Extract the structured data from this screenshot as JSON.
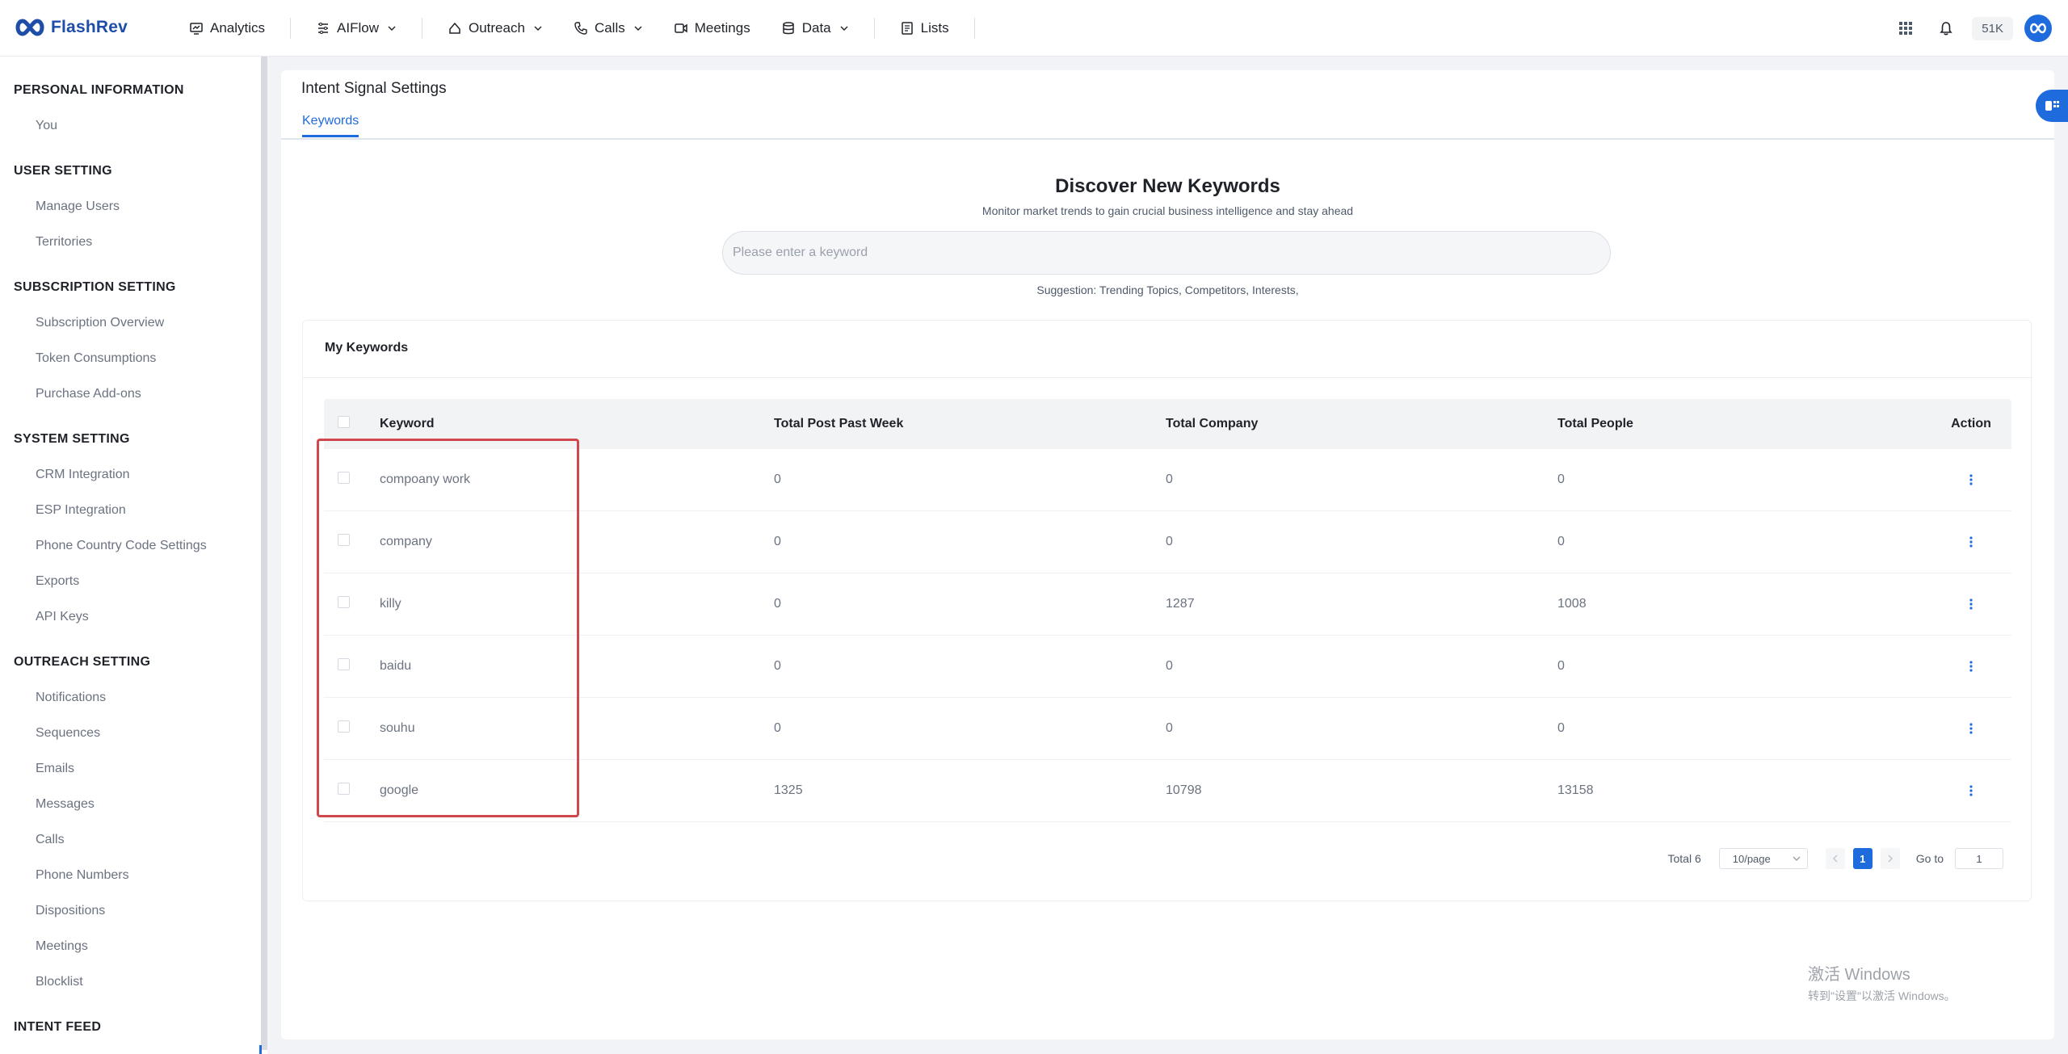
{
  "brand": {
    "name": "FlashRev"
  },
  "nav": {
    "items": [
      {
        "label": "Analytics",
        "icon": "analytics-icon",
        "dropdown": false
      },
      {
        "label": "AIFlow",
        "icon": "flow-icon",
        "dropdown": true
      },
      {
        "label": "Outreach",
        "icon": "outreach-icon",
        "dropdown": true
      },
      {
        "label": "Calls",
        "icon": "phone-icon",
        "dropdown": true
      },
      {
        "label": "Meetings",
        "icon": "video-icon",
        "dropdown": false
      },
      {
        "label": "Data",
        "icon": "database-icon",
        "dropdown": true
      },
      {
        "label": "Lists",
        "icon": "list-icon",
        "dropdown": false
      }
    ],
    "credits": "51K"
  },
  "sidebar": {
    "sections": [
      {
        "title": "PERSONAL INFORMATION",
        "items": [
          "You"
        ]
      },
      {
        "title": "USER SETTING",
        "items": [
          "Manage Users",
          "Territories"
        ]
      },
      {
        "title": "SUBSCRIPTION SETTING",
        "items": [
          "Subscription Overview",
          "Token Consumptions",
          "Purchase Add-ons"
        ]
      },
      {
        "title": "SYSTEM SETTING",
        "items": [
          "CRM Integration",
          "ESP Integration",
          "Phone Country Code Settings",
          "Exports",
          "API Keys"
        ]
      },
      {
        "title": "OUTREACH SETTING",
        "items": [
          "Notifications",
          "Sequences",
          "Emails",
          "Messages",
          "Calls",
          "Phone Numbers",
          "Dispositions",
          "Meetings",
          "Blocklist"
        ]
      },
      {
        "title": "INTENT FEED",
        "items": []
      }
    ]
  },
  "page": {
    "title": "Intent Signal Settings",
    "tab": "Keywords"
  },
  "discover": {
    "title": "Discover New Keywords",
    "subtitle": "Monitor market trends to gain crucial business intelligence and stay ahead",
    "placeholder": "Please enter a keyword",
    "suggestion": "Suggestion: Trending Topics, Competitors, Interests,"
  },
  "keywords": {
    "title": "My Keywords",
    "columns": {
      "keyword": "Keyword",
      "posts": "Total Post Past Week",
      "company": "Total Company",
      "people": "Total People",
      "action": "Action"
    },
    "rows": [
      {
        "keyword": "compoany work",
        "posts": "0",
        "company": "0",
        "people": "0"
      },
      {
        "keyword": "company",
        "posts": "0",
        "company": "0",
        "people": "0"
      },
      {
        "keyword": "killy",
        "posts": "0",
        "company": "1287",
        "people": "1008"
      },
      {
        "keyword": "baidu",
        "posts": "0",
        "company": "0",
        "people": "0"
      },
      {
        "keyword": "souhu",
        "posts": "0",
        "company": "0",
        "people": "0"
      },
      {
        "keyword": "google",
        "posts": "1325",
        "company": "10798",
        "people": "13158"
      }
    ]
  },
  "pagination": {
    "total": "Total 6",
    "page_size": "10/page",
    "current_page": "1",
    "goto_label": "Go to",
    "goto_value": "1"
  },
  "watermark": {
    "line1": "激活 Windows",
    "line2": "转到\"设置\"以激活 Windows。"
  },
  "colors": {
    "accent": "#1e6bde",
    "brand": "#1e4ea8",
    "highlight": "#d0484b"
  }
}
